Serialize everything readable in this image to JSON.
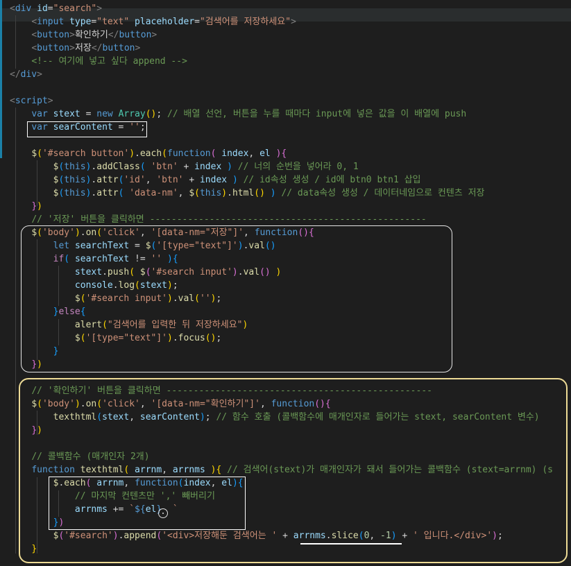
{
  "editor": {
    "lines": [
      [
        [
          "t-br",
          "<"
        ],
        [
          "t-tag",
          "div"
        ],
        [
          "t-txt",
          " "
        ],
        [
          "t-attr",
          "id"
        ],
        [
          "t-txt",
          "="
        ],
        [
          "t-str",
          "\"search\""
        ],
        [
          "t-br",
          ">"
        ]
      ],
      [
        [
          "t-txt",
          "    "
        ],
        [
          "t-br",
          "<"
        ],
        [
          "t-tag",
          "input"
        ],
        [
          "t-txt",
          " "
        ],
        [
          "t-attr",
          "type"
        ],
        [
          "t-txt",
          "="
        ],
        [
          "t-str",
          "\"text\""
        ],
        [
          "t-txt",
          " "
        ],
        [
          "t-attr",
          "placeholder"
        ],
        [
          "t-txt",
          "="
        ],
        [
          "t-str",
          "\"검색어를 저장하세요\""
        ],
        [
          "t-br",
          ">"
        ]
      ],
      [
        [
          "t-txt",
          "    "
        ],
        [
          "t-br",
          "<"
        ],
        [
          "t-tag",
          "button"
        ],
        [
          "t-br",
          ">"
        ],
        [
          "t-txt",
          "확인하기"
        ],
        [
          "t-br",
          "</"
        ],
        [
          "t-tag",
          "button"
        ],
        [
          "t-br",
          ">"
        ]
      ],
      [
        [
          "t-txt",
          "    "
        ],
        [
          "t-br",
          "<"
        ],
        [
          "t-tag",
          "button"
        ],
        [
          "t-br",
          ">"
        ],
        [
          "t-txt",
          "저장"
        ],
        [
          "t-br",
          "</"
        ],
        [
          "t-tag",
          "button"
        ],
        [
          "t-br",
          ">"
        ]
      ],
      [
        [
          "t-txt",
          "    "
        ],
        [
          "t-cmt",
          "<!-- 여기에 넣고 싶다 append -->"
        ]
      ],
      [
        [
          "t-br",
          "</"
        ],
        [
          "t-tag",
          "div"
        ],
        [
          "t-br",
          ">"
        ]
      ],
      [],
      [
        [
          "t-br",
          "<"
        ],
        [
          "t-tag",
          "script"
        ],
        [
          "t-br",
          ">"
        ]
      ],
      [
        [
          "t-txt",
          "    "
        ],
        [
          "t-kw",
          "var"
        ],
        [
          "t-txt",
          " "
        ],
        [
          "t-var",
          "stext"
        ],
        [
          "t-txt",
          " = "
        ],
        [
          "t-kw",
          "new"
        ],
        [
          "t-txt",
          " "
        ],
        [
          "t-cls",
          "Array"
        ],
        [
          "t-p1",
          "()"
        ],
        [
          "t-txt",
          "; "
        ],
        [
          "t-cmt",
          "// 배열 선언, 버튼을 누를 때마다 input에 넣은 값을 이 배열에 push"
        ]
      ],
      [
        [
          "t-txt",
          "    "
        ],
        [
          "t-kw",
          "var"
        ],
        [
          "t-txt",
          " "
        ],
        [
          "t-var",
          "searContent"
        ],
        [
          "t-txt",
          " = "
        ],
        [
          "t-str",
          "''"
        ],
        [
          "t-txt",
          ";"
        ]
      ],
      [],
      [
        [
          "t-txt",
          "    "
        ],
        [
          "t-fn",
          "$"
        ],
        [
          "t-p1",
          "("
        ],
        [
          "t-str",
          "'#search button'"
        ],
        [
          "t-p1",
          ")"
        ],
        [
          "t-txt",
          "."
        ],
        [
          "t-fn",
          "each"
        ],
        [
          "t-p1",
          "("
        ],
        [
          "t-kw",
          "function"
        ],
        [
          "t-p2",
          "("
        ],
        [
          "t-txt",
          " "
        ],
        [
          "t-var",
          "index"
        ],
        [
          "t-txt",
          ", "
        ],
        [
          "t-var",
          "el"
        ],
        [
          "t-txt",
          " "
        ],
        [
          "t-p2",
          ")"
        ],
        [
          "t-p2",
          "{"
        ]
      ],
      [
        [
          "t-txt",
          "        "
        ],
        [
          "t-fn",
          "$"
        ],
        [
          "t-p3",
          "("
        ],
        [
          "t-kw",
          "this"
        ],
        [
          "t-p3",
          ")"
        ],
        [
          "t-txt",
          "."
        ],
        [
          "t-fn",
          "addClass"
        ],
        [
          "t-p3",
          "("
        ],
        [
          "t-txt",
          " "
        ],
        [
          "t-str",
          "'btn'"
        ],
        [
          "t-txt",
          " + "
        ],
        [
          "t-var",
          "index"
        ],
        [
          "t-txt",
          " "
        ],
        [
          "t-p3",
          ")"
        ],
        [
          "t-txt",
          " "
        ],
        [
          "t-cmt",
          "// 너의 순번을 넣어라 0, 1"
        ]
      ],
      [
        [
          "t-txt",
          "        "
        ],
        [
          "t-fn",
          "$"
        ],
        [
          "t-p3",
          "("
        ],
        [
          "t-kw",
          "this"
        ],
        [
          "t-p3",
          ")"
        ],
        [
          "t-txt",
          "."
        ],
        [
          "t-fn",
          "attr"
        ],
        [
          "t-p3",
          "("
        ],
        [
          "t-str",
          "'id'"
        ],
        [
          "t-txt",
          ", "
        ],
        [
          "t-str",
          "'btn'"
        ],
        [
          "t-txt",
          " + "
        ],
        [
          "t-var",
          "index"
        ],
        [
          "t-txt",
          " "
        ],
        [
          "t-p3",
          ")"
        ],
        [
          "t-txt",
          " "
        ],
        [
          "t-cmt",
          "// id속성 생성 / id에 btn0 btn1 삽입"
        ]
      ],
      [
        [
          "t-txt",
          "        "
        ],
        [
          "t-fn",
          "$"
        ],
        [
          "t-p3",
          "("
        ],
        [
          "t-kw",
          "this"
        ],
        [
          "t-p3",
          ")"
        ],
        [
          "t-txt",
          "."
        ],
        [
          "t-fn",
          "attr"
        ],
        [
          "t-p3",
          "("
        ],
        [
          "t-txt",
          " "
        ],
        [
          "t-str",
          "'data-nm'"
        ],
        [
          "t-txt",
          ", "
        ],
        [
          "t-fn",
          "$"
        ],
        [
          "t-p1",
          "("
        ],
        [
          "t-kw",
          "this"
        ],
        [
          "t-p1",
          ")"
        ],
        [
          "t-txt",
          "."
        ],
        [
          "t-fn",
          "html"
        ],
        [
          "t-p1",
          "()"
        ],
        [
          "t-txt",
          " "
        ],
        [
          "t-p3",
          ")"
        ],
        [
          "t-txt",
          " "
        ],
        [
          "t-cmt",
          "// data속성 생성 / 데이터네임으로 컨텐츠 저장"
        ]
      ],
      [
        [
          "t-txt",
          "    "
        ],
        [
          "t-p2",
          "}"
        ],
        [
          "t-p1",
          ")"
        ]
      ],
      [
        [
          "t-txt",
          "    "
        ],
        [
          "t-cmt",
          "// '저장' 버튼을 클릭하면 ---------------------------------------------------"
        ]
      ],
      [
        [
          "t-txt",
          "    "
        ],
        [
          "t-fn",
          "$"
        ],
        [
          "t-p1",
          "("
        ],
        [
          "t-str",
          "'body'"
        ],
        [
          "t-p1",
          ")"
        ],
        [
          "t-txt",
          "."
        ],
        [
          "t-fn",
          "on"
        ],
        [
          "t-p1",
          "("
        ],
        [
          "t-str",
          "'click'"
        ],
        [
          "t-txt",
          ", "
        ],
        [
          "t-str",
          "'[data-nm=\"저장\"]'"
        ],
        [
          "t-txt",
          ", "
        ],
        [
          "t-kw",
          "function"
        ],
        [
          "t-p2",
          "()"
        ],
        [
          "t-p2",
          "{"
        ]
      ],
      [
        [
          "t-txt",
          "        "
        ],
        [
          "t-kw",
          "let"
        ],
        [
          "t-txt",
          " "
        ],
        [
          "t-var",
          "searchText"
        ],
        [
          "t-txt",
          " = "
        ],
        [
          "t-fn",
          "$"
        ],
        [
          "t-p3",
          "("
        ],
        [
          "t-str",
          "'[type=\"text\"]'"
        ],
        [
          "t-p3",
          ")"
        ],
        [
          "t-txt",
          "."
        ],
        [
          "t-fn",
          "val"
        ],
        [
          "t-p3",
          "()"
        ]
      ],
      [
        [
          "t-txt",
          "        "
        ],
        [
          "t-ctl",
          "if"
        ],
        [
          "t-p3",
          "("
        ],
        [
          "t-txt",
          " "
        ],
        [
          "t-var",
          "searchText"
        ],
        [
          "t-txt",
          " != "
        ],
        [
          "t-str",
          "''"
        ],
        [
          "t-txt",
          " "
        ],
        [
          "t-p3",
          ")"
        ],
        [
          "t-p3",
          "{"
        ]
      ],
      [
        [
          "t-txt",
          "            "
        ],
        [
          "t-var",
          "stext"
        ],
        [
          "t-txt",
          "."
        ],
        [
          "t-fn",
          "push"
        ],
        [
          "t-p1",
          "("
        ],
        [
          "t-txt",
          " "
        ],
        [
          "t-fn",
          "$"
        ],
        [
          "t-p2",
          "("
        ],
        [
          "t-str",
          "'#search input'"
        ],
        [
          "t-p2",
          ")"
        ],
        [
          "t-txt",
          "."
        ],
        [
          "t-fn",
          "val"
        ],
        [
          "t-p2",
          "()"
        ],
        [
          "t-txt",
          " "
        ],
        [
          "t-p1",
          ")"
        ]
      ],
      [
        [
          "t-txt",
          "            "
        ],
        [
          "t-var",
          "console"
        ],
        [
          "t-txt",
          "."
        ],
        [
          "t-fn",
          "log"
        ],
        [
          "t-p1",
          "("
        ],
        [
          "t-var",
          "stext"
        ],
        [
          "t-p1",
          ")"
        ],
        [
          "t-txt",
          ";"
        ]
      ],
      [
        [
          "t-txt",
          "            "
        ],
        [
          "t-fn",
          "$"
        ],
        [
          "t-p1",
          "("
        ],
        [
          "t-str",
          "'#search input'"
        ],
        [
          "t-p1",
          ")"
        ],
        [
          "t-txt",
          "."
        ],
        [
          "t-fn",
          "val"
        ],
        [
          "t-p1",
          "("
        ],
        [
          "t-str",
          "''"
        ],
        [
          "t-p1",
          ")"
        ],
        [
          "t-txt",
          ";"
        ]
      ],
      [
        [
          "t-txt",
          "        "
        ],
        [
          "t-p3",
          "}"
        ],
        [
          "t-ctl",
          "else"
        ],
        [
          "t-p3",
          "{"
        ]
      ],
      [
        [
          "t-txt",
          "            "
        ],
        [
          "t-fn",
          "alert"
        ],
        [
          "t-p1",
          "("
        ],
        [
          "t-str",
          "\"검색어를 입력한 뒤 저장하세요\""
        ],
        [
          "t-p1",
          ")"
        ]
      ],
      [
        [
          "t-txt",
          "            "
        ],
        [
          "t-fn",
          "$"
        ],
        [
          "t-p1",
          "("
        ],
        [
          "t-str",
          "'[type=\"text\"]'"
        ],
        [
          "t-p1",
          ")"
        ],
        [
          "t-txt",
          "."
        ],
        [
          "t-fn",
          "focus"
        ],
        [
          "t-p1",
          "()"
        ],
        [
          "t-txt",
          ";"
        ]
      ],
      [
        [
          "t-txt",
          "        "
        ],
        [
          "t-p3",
          "}"
        ]
      ],
      [
        [
          "t-txt",
          "    "
        ],
        [
          "t-p2",
          "}"
        ],
        [
          "t-p1",
          ")"
        ]
      ],
      [],
      [
        [
          "t-txt",
          "    "
        ],
        [
          "t-cmt",
          "// '확인하기' 버튼을 클릭하면 -------------------------------------------------"
        ]
      ],
      [
        [
          "t-txt",
          "    "
        ],
        [
          "t-fn",
          "$"
        ],
        [
          "t-p1",
          "("
        ],
        [
          "t-str",
          "'body'"
        ],
        [
          "t-p1",
          ")"
        ],
        [
          "t-txt",
          "."
        ],
        [
          "t-fn",
          "on"
        ],
        [
          "t-p1",
          "("
        ],
        [
          "t-str",
          "'click'"
        ],
        [
          "t-txt",
          ", "
        ],
        [
          "t-str",
          "'[data-nm=\"확인하기\"]'"
        ],
        [
          "t-txt",
          ", "
        ],
        [
          "t-kw",
          "function"
        ],
        [
          "t-p2",
          "()"
        ],
        [
          "t-p2",
          "{"
        ]
      ],
      [
        [
          "t-txt",
          "        "
        ],
        [
          "t-fn",
          "texthtml"
        ],
        [
          "t-p3",
          "("
        ],
        [
          "t-var",
          "stext"
        ],
        [
          "t-txt",
          ", "
        ],
        [
          "t-var",
          "searContent"
        ],
        [
          "t-p3",
          ")"
        ],
        [
          "t-txt",
          "; "
        ],
        [
          "t-cmt",
          "// 함수 호출 (콜백함수에 매개인자로 들어가는 stext, searContent 변수)"
        ]
      ],
      [
        [
          "t-txt",
          "    "
        ],
        [
          "t-p2",
          "}"
        ],
        [
          "t-p1",
          ")"
        ]
      ],
      [],
      [
        [
          "t-txt",
          "    "
        ],
        [
          "t-cmt",
          "// 콜백함수 (매개인자 2개)"
        ]
      ],
      [
        [
          "t-txt",
          "    "
        ],
        [
          "t-kw",
          "function"
        ],
        [
          "t-txt",
          " "
        ],
        [
          "t-fn",
          "texthtml"
        ],
        [
          "t-p1",
          "("
        ],
        [
          "t-txt",
          " "
        ],
        [
          "t-var",
          "arrnm"
        ],
        [
          "t-txt",
          ", "
        ],
        [
          "t-var",
          "arrnms"
        ],
        [
          "t-txt",
          " "
        ],
        [
          "t-p1",
          ")"
        ],
        [
          "t-p1",
          "{"
        ],
        [
          "t-txt",
          " "
        ],
        [
          "t-cmt",
          "// 검색어(stext)가 매개인자가 돼서 들어가는 콜백함수 (stext=arrnm) (s"
        ]
      ],
      [
        [
          "t-txt",
          "        "
        ],
        [
          "t-fn",
          "$"
        ],
        [
          "t-txt",
          "."
        ],
        [
          "t-fn",
          "each"
        ],
        [
          "t-p2",
          "("
        ],
        [
          "t-txt",
          " "
        ],
        [
          "t-var",
          "arrnm"
        ],
        [
          "t-txt",
          ", "
        ],
        [
          "t-kw",
          "function"
        ],
        [
          "t-p3",
          "("
        ],
        [
          "t-var",
          "index"
        ],
        [
          "t-txt",
          ", "
        ],
        [
          "t-var",
          "el"
        ],
        [
          "t-p3",
          ")"
        ],
        [
          "t-p3",
          "{"
        ]
      ],
      [
        [
          "t-txt",
          "            "
        ],
        [
          "t-cmt",
          "// 마지막 컨텐츠만 ',' 빼버리기"
        ]
      ],
      [
        [
          "t-txt",
          "            "
        ],
        [
          "t-var",
          "arrnms"
        ],
        [
          "t-txt",
          " += "
        ],
        [
          "t-str",
          "`"
        ],
        [
          "t-kw",
          "${"
        ],
        [
          "t-var",
          "el"
        ],
        [
          "t-kw",
          "}"
        ],
        [
          "t-str",
          "  `"
        ]
      ],
      [
        [
          "t-txt",
          "        "
        ],
        [
          "t-p3",
          "}"
        ],
        [
          "t-p2",
          ")"
        ]
      ],
      [
        [
          "t-txt",
          "        "
        ],
        [
          "t-fn",
          "$"
        ],
        [
          "t-p2",
          "("
        ],
        [
          "t-str",
          "'#search'"
        ],
        [
          "t-p2",
          ")"
        ],
        [
          "t-txt",
          "."
        ],
        [
          "t-fn",
          "append"
        ],
        [
          "t-p2",
          "("
        ],
        [
          "t-str",
          "'<div>저장해둔 검색어는 '"
        ],
        [
          "t-txt",
          " + "
        ],
        [
          "t-var",
          "arrnms"
        ],
        [
          "t-txt",
          "."
        ],
        [
          "t-fn",
          "slice"
        ],
        [
          "t-p3",
          "("
        ],
        [
          "t-num",
          "0"
        ],
        [
          "t-txt",
          ", "
        ],
        [
          "t-num",
          "-1"
        ],
        [
          "t-p3",
          ")"
        ],
        [
          "t-txt",
          " + "
        ],
        [
          "t-str",
          "' 입니다.</div>'"
        ],
        [
          "t-p2",
          ")"
        ],
        [
          "t-txt",
          ";"
        ]
      ],
      [
        [
          "t-txt",
          "    "
        ],
        [
          "t-p1",
          "}"
        ]
      ]
    ]
  }
}
